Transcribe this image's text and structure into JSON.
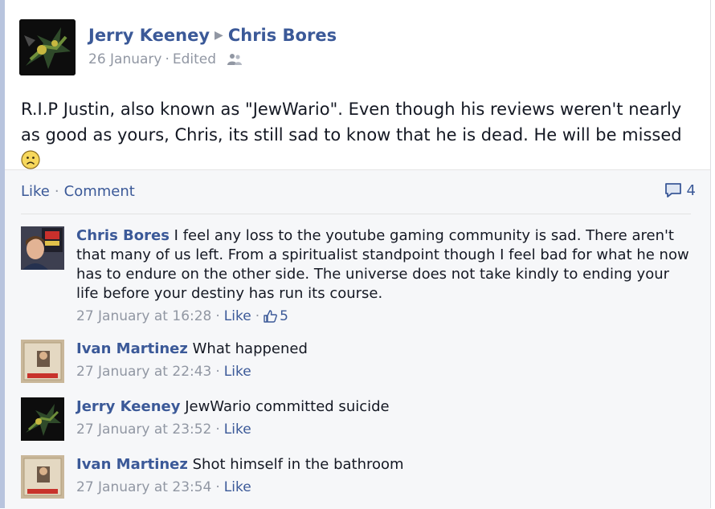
{
  "post": {
    "author": "Jerry Keeney",
    "target": "Chris Bores",
    "date": "26 January",
    "edited": "Edited",
    "text": "R.I.P Justin, also known as \"JewWario\". Even though his reviews weren't nearly as good as yours, Chris, its still sad to know that he is dead. He will be missed"
  },
  "actions": {
    "like": "Like",
    "comment": "Comment",
    "comment_count": "4"
  },
  "comments": [
    {
      "author": "Chris Bores",
      "text": "I feel any loss to the youtube gaming community is sad. There aren't that many of us left. From a spiritualist standpoint though I feel bad for what he now has to endure on the other side. The universe does not take kindly to ending your life before your destiny has run its course.",
      "time": "27 January at 16:28",
      "like": "Like",
      "likes": "5"
    },
    {
      "author": "Ivan Martinez",
      "text": "What happened",
      "time": "27 January at 22:43",
      "like": "Like"
    },
    {
      "author": "Jerry Keeney",
      "text": "JewWario committed suicide",
      "time": "27 January at 23:52",
      "like": "Like"
    },
    {
      "author": "Ivan Martinez",
      "text": "Shot himself in the bathroom",
      "time": "27 January at 23:54",
      "like": "Like"
    }
  ],
  "colors": {
    "link": "#3b5998",
    "meta": "#9197a3",
    "feedback_bg": "#f6f7f9"
  },
  "icons": {
    "audience": "friends-icon",
    "comment": "comment-bubble-icon",
    "like": "thumbs-up-icon",
    "emoticon": "frown-emoticon-icon"
  }
}
